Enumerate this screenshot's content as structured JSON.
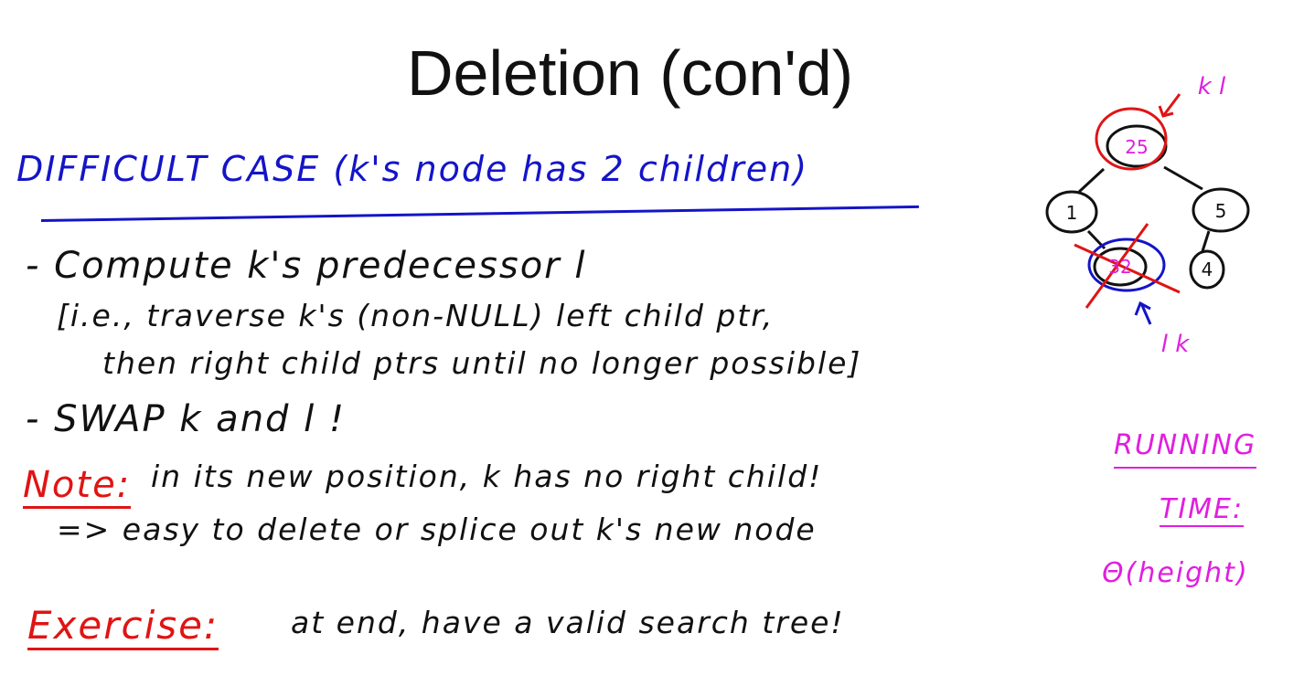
{
  "title": "Deletion (con'd)",
  "heading": "DIFFICULT CASE (k's node has 2 children)",
  "bullets": [
    "- Compute k's predecessor l",
    "[i.e., traverse k's (non-NULL) left child ptr,",
    "then right child ptrs until no longer possible]",
    "- SWAP k and l !"
  ],
  "note": {
    "label": "Note:",
    "line1": "in its new position, k has no right child!",
    "line2": "=> easy to delete or splice out k's new node"
  },
  "exercise": {
    "label": "Exercise:",
    "text": "at end, have a valid search tree!"
  },
  "running_time": {
    "line1": "RUNNING",
    "line2": "TIME:",
    "line3": "Θ(height)"
  },
  "tree": {
    "root": "25",
    "left": "1",
    "right": "5",
    "left_right": "32",
    "right_left": "4",
    "top_label": "k l",
    "bottom_label": "l k"
  },
  "colors": {
    "blue": "#1414c8",
    "red": "#e01414",
    "magenta": "#e01ee0"
  }
}
